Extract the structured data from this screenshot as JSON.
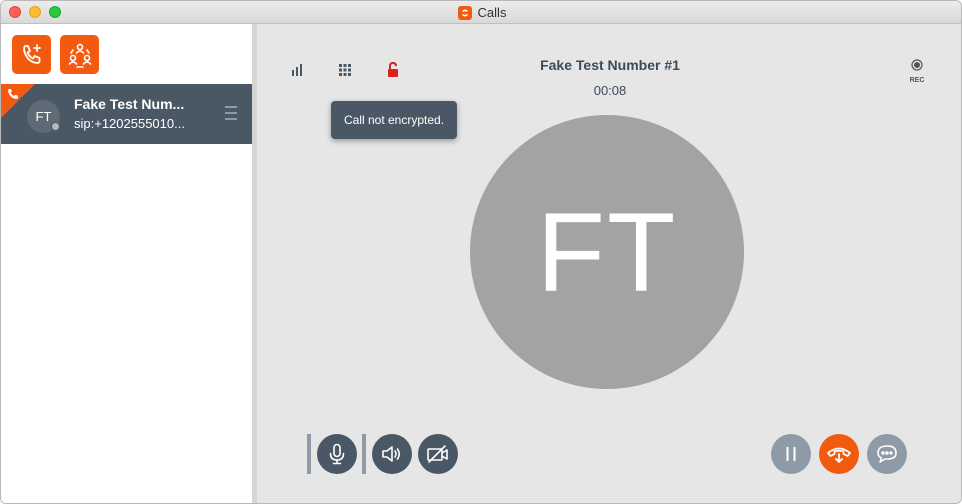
{
  "window": {
    "title": "Calls"
  },
  "sidebar": {
    "new_call_icon": "phone-plus-icon",
    "conference_icon": "group-call-icon",
    "call_item": {
      "initials": "FT",
      "name": "Fake Test Num...",
      "sip": "sip:+1202555010...",
      "active_icon": "phone-icon"
    }
  },
  "call": {
    "name": "Fake Test Number #1",
    "duration": "00:08",
    "initials": "FT",
    "tooltip": "Call not encrypted.",
    "rec_label": "REC",
    "encryption_status": "not-encrypted",
    "unlock_color": "#e0211b"
  },
  "controls": {
    "mute": "microphone-icon",
    "speaker": "speaker-icon",
    "video": "video-off-icon",
    "hold": "pause-icon",
    "hangup": "hangup-icon",
    "chat": "chat-icon"
  },
  "colors": {
    "accent": "#f25a0f",
    "dark": "#4a5865",
    "muted": "#8e9ba7"
  }
}
